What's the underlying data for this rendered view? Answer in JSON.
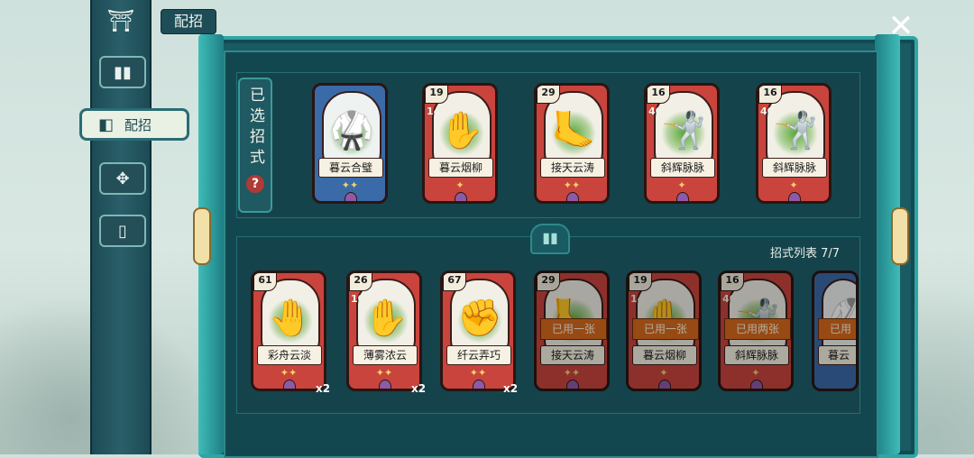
{
  "header": {
    "title": "配招",
    "close_icon": "close-icon"
  },
  "sidebar": {
    "home_icon": "pavilion-icon",
    "items": [
      {
        "icon": "cards-icon"
      },
      {
        "icon": "deck-icon",
        "label": "配招",
        "active": true
      },
      {
        "icon": "emblem-icon"
      },
      {
        "icon": "card-icon"
      }
    ]
  },
  "selected_section": {
    "label": "已选招式",
    "help": "?"
  },
  "selected_cards": [
    {
      "name": "暮云合璧",
      "color": "blue",
      "cost": "",
      "subcost": "",
      "stars": "✦✦"
    },
    {
      "name": "暮云烟柳",
      "color": "red",
      "cost": "19",
      "subcost": "14",
      "stars": "✦"
    },
    {
      "name": "接天云涛",
      "color": "red",
      "cost": "29",
      "subcost": "",
      "stars": "✦✦"
    },
    {
      "name": "斜辉脉脉",
      "color": "red",
      "cost": "16",
      "subcost": "40",
      "stars": "✦"
    },
    {
      "name": "斜辉脉脉",
      "color": "red",
      "cost": "16",
      "subcost": "40",
      "stars": "✦"
    }
  ],
  "list_section": {
    "label": "招式列表 7/7"
  },
  "list_cards": [
    {
      "name": "彩舟云淡",
      "cost": "61",
      "subcost": "",
      "stars": "✦✦",
      "qty": "x2",
      "badge": ""
    },
    {
      "name": "薄雾浓云",
      "cost": "26",
      "subcost": "10",
      "stars": "✦✦",
      "qty": "x2",
      "badge": ""
    },
    {
      "name": "纤云弄巧",
      "cost": "67",
      "subcost": "",
      "stars": "✦✦",
      "qty": "x2",
      "badge": ""
    },
    {
      "name": "接天云涛",
      "cost": "29",
      "subcost": "",
      "stars": "✦✦",
      "qty": "",
      "badge": "已用一张"
    },
    {
      "name": "暮云烟柳",
      "cost": "19",
      "subcost": "14",
      "stars": "✦",
      "qty": "",
      "badge": "已用一张"
    },
    {
      "name": "斜辉脉脉",
      "cost": "16",
      "subcost": "40",
      "stars": "✦",
      "qty": "",
      "badge": "已用两张"
    },
    {
      "name": "暮云",
      "cost": "",
      "subcost": "",
      "stars": "✦✦",
      "qty": "",
      "badge": "已用"
    }
  ]
}
